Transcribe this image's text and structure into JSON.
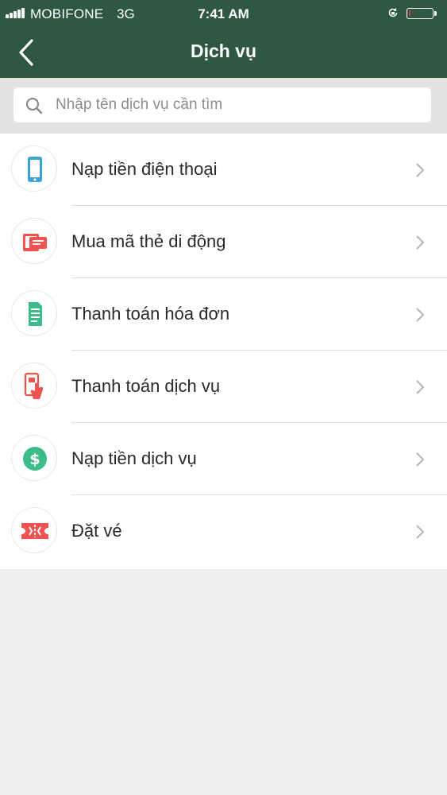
{
  "status_bar": {
    "carrier": "MOBIFONE",
    "network": "3G",
    "time": "7:41 AM",
    "battery_level": 0.08,
    "battery_color": "#e53935"
  },
  "header": {
    "title": "Dịch vụ",
    "background_color": "#2f5840",
    "back_icon": "chevron-left-icon"
  },
  "search": {
    "placeholder": "Nhập tên dịch vụ cần tìm",
    "value": "",
    "icon": "search-icon"
  },
  "services": [
    {
      "label": "Nạp tiền điện thoại",
      "icon": "phone-icon",
      "color": "#3ba3d8"
    },
    {
      "label": "Mua mã thẻ di động",
      "icon": "card-icon",
      "color": "#ef5350"
    },
    {
      "label": "Thanh toán hóa đơn",
      "icon": "bill-icon",
      "color": "#3dbb88"
    },
    {
      "label": "Thanh toán dịch vụ",
      "icon": "tap-phone-icon",
      "color": "#ef5350"
    },
    {
      "label": "Nạp tiền dịch vụ",
      "icon": "dollar-coin-icon",
      "color": "#3dbb88"
    },
    {
      "label": "Đặt vé",
      "icon": "ticket-icon",
      "color": "#ef5350"
    }
  ]
}
